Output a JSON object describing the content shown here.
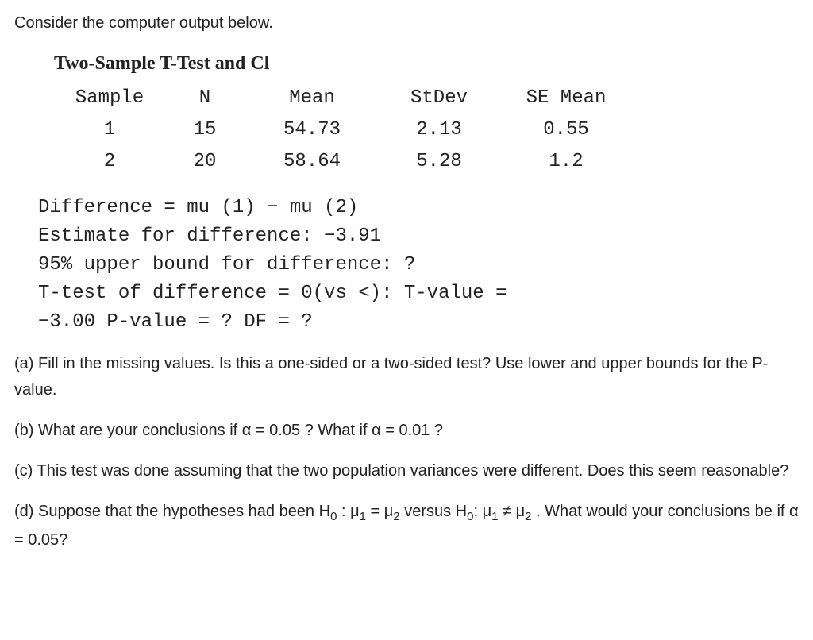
{
  "intro": "Consider the computer output below.",
  "output": {
    "title": "Two-Sample T-Test and Cl",
    "headers": {
      "sample": "Sample",
      "n": "N",
      "mean": "Mean",
      "stdev": "StDev",
      "se": "SE Mean"
    },
    "rows": [
      {
        "sample": "1",
        "n": "15",
        "mean": "54.73",
        "stdev": "2.13",
        "se": "0.55"
      },
      {
        "sample": "2",
        "n": "20",
        "mean": "58.64",
        "stdev": "5.28",
        "se": "1.2"
      }
    ],
    "diff_label": "Difference = mu (1) − mu (2)",
    "estimate": "Estimate for difference: −3.91",
    "upper_bound": "95% upper bound for difference: ?",
    "ttest_line": "T-test of difference = 0(vs <): T-value =",
    "tvalue_line": "−3.00 P-value = ? DF = ?"
  },
  "questions": {
    "a": "(a) Fill in the missing values. Is this a one-sided or a two-sided test? Use lower and upper bounds for the P-value.",
    "b_prefix": "(b) What are your conclusions if ",
    "b_mid": " ? What if ",
    "b_suffix": " ?",
    "alpha05": "α = 0.05",
    "alpha01": "α = 0.01",
    "c": "(c) This test was done assuming that the two population variances were different. Does this seem reasonable?",
    "d_prefix": "(d) Suppose that the hypotheses had been ",
    "d_h0a": "H",
    "d_sub0": "0",
    "d_colon": " : ",
    "mu": "μ",
    "sub1": "1",
    "sub2": "2",
    "eq": " = ",
    "neq": " ≠ ",
    "versus": " versus ",
    "d_suffix": " . What would your conclusions be if ",
    "d_end": "?"
  }
}
